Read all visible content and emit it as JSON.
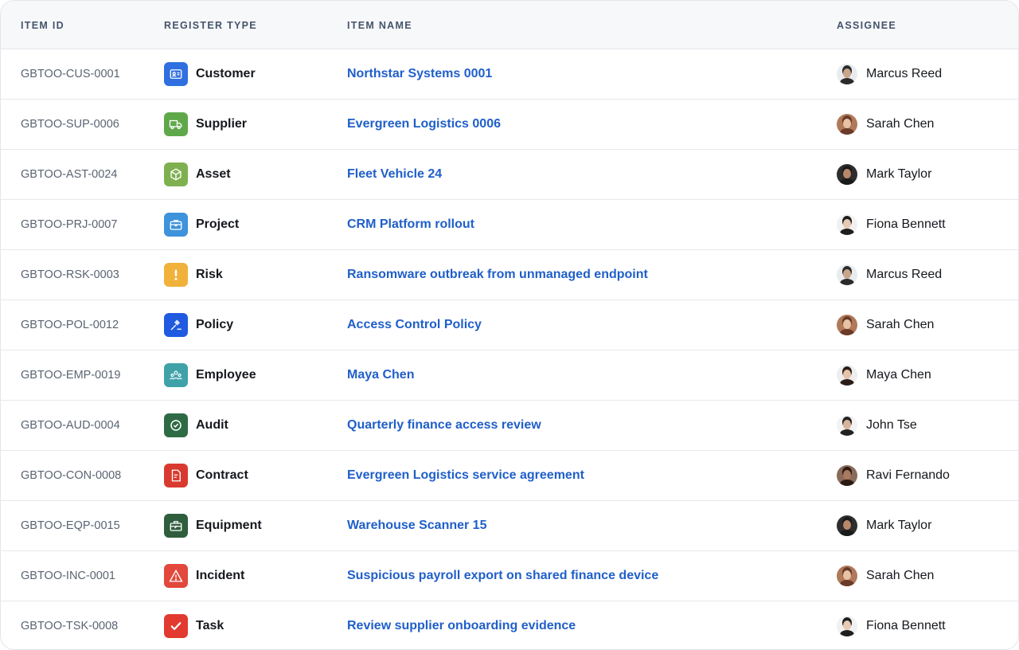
{
  "headers": {
    "item_id": "ITEM ID",
    "register_type": "REGISTER TYPE",
    "item_name": "ITEM NAME",
    "assignee": "ASSIGNEE"
  },
  "rows": [
    {
      "id": "GBTOO-CUS-0001",
      "type": "Customer",
      "type_icon": "id-card-icon",
      "type_color": "#2f6fe0",
      "name": "Northstar Systems 0001",
      "assignee": "Marcus Reed",
      "avatar_bg": "#e9ecef",
      "avatar_face": "#c9a58a",
      "avatar_hair": "#2b2b2b"
    },
    {
      "id": "GBTOO-SUP-0006",
      "type": "Supplier",
      "type_icon": "truck-icon",
      "type_color": "#5fa84a",
      "name": "Evergreen Logistics 0006",
      "assignee": "Sarah Chen",
      "avatar_bg": "#b07a5a",
      "avatar_face": "#e8c2a5",
      "avatar_hair": "#6a3b28"
    },
    {
      "id": "GBTOO-AST-0024",
      "type": "Asset",
      "type_icon": "cube-icon",
      "type_color": "#7fb04f",
      "name": "Fleet Vehicle 24",
      "assignee": "Mark Taylor",
      "avatar_bg": "#2e2e2e",
      "avatar_face": "#b9876a",
      "avatar_hair": "#1a1a1a"
    },
    {
      "id": "GBTOO-PRJ-0007",
      "type": "Project",
      "type_icon": "briefcase-icon",
      "type_color": "#3d93dc",
      "name": "CRM Platform rollout",
      "assignee": "Fiona Bennett",
      "avatar_bg": "#f1f1f1",
      "avatar_face": "#e8c9b4",
      "avatar_hair": "#1e1e1e"
    },
    {
      "id": "GBTOO-RSK-0003",
      "type": "Risk",
      "type_icon": "exclamation-icon",
      "type_color": "#f0b23a",
      "name": "Ransomware outbreak from unmanaged endpoint",
      "assignee": "Marcus Reed",
      "avatar_bg": "#e9ecef",
      "avatar_face": "#c9a58a",
      "avatar_hair": "#2b2b2b"
    },
    {
      "id": "GBTOO-POL-0012",
      "type": "Policy",
      "type_icon": "gavel-icon",
      "type_color": "#1f5ae0",
      "name": "Access Control Policy",
      "assignee": "Sarah Chen",
      "avatar_bg": "#b07a5a",
      "avatar_face": "#e8c2a5",
      "avatar_hair": "#6a3b28"
    },
    {
      "id": "GBTOO-EMP-0019",
      "type": "Employee",
      "type_icon": "people-icon",
      "type_color": "#3fa2a8",
      "name": "Maya Chen",
      "assignee": "Maya Chen",
      "avatar_bg": "#eeeeee",
      "avatar_face": "#e6c2a8",
      "avatar_hair": "#2a1c16"
    },
    {
      "id": "GBTOO-AUD-0004",
      "type": "Audit",
      "type_icon": "check-circle-icon",
      "type_color": "#2e6b45",
      "name": "Quarterly finance access review",
      "assignee": "John Tse",
      "avatar_bg": "#f3f3f3",
      "avatar_face": "#d8b49a",
      "avatar_hair": "#222222"
    },
    {
      "id": "GBTOO-CON-0008",
      "type": "Contract",
      "type_icon": "document-icon",
      "type_color": "#d93a2f",
      "name": "Evergreen Logistics service agreement",
      "assignee": "Ravi Fernando",
      "avatar_bg": "#8a6a5a",
      "avatar_face": "#a97a5e",
      "avatar_hair": "#2a1a12"
    },
    {
      "id": "GBTOO-EQP-0015",
      "type": "Equipment",
      "type_icon": "toolbox-icon",
      "type_color": "#2f5e3c",
      "name": "Warehouse Scanner 15",
      "assignee": "Mark Taylor",
      "avatar_bg": "#2e2e2e",
      "avatar_face": "#b9876a",
      "avatar_hair": "#1a1a1a"
    },
    {
      "id": "GBTOO-INC-0001",
      "type": "Incident",
      "type_icon": "warning-triangle-icon",
      "type_color": "#e2483b",
      "name": "Suspicious payroll export on shared finance device",
      "assignee": "Sarah Chen",
      "avatar_bg": "#b07a5a",
      "avatar_face": "#e8c2a5",
      "avatar_hair": "#6a3b28"
    },
    {
      "id": "GBTOO-TSK-0008",
      "type": "Task",
      "type_icon": "checkmark-icon",
      "type_color": "#e23a30",
      "name": "Review supplier onboarding evidence",
      "assignee": "Fiona Bennett",
      "avatar_bg": "#f1f1f1",
      "avatar_face": "#e8c9b4",
      "avatar_hair": "#1e1e1e"
    }
  ]
}
